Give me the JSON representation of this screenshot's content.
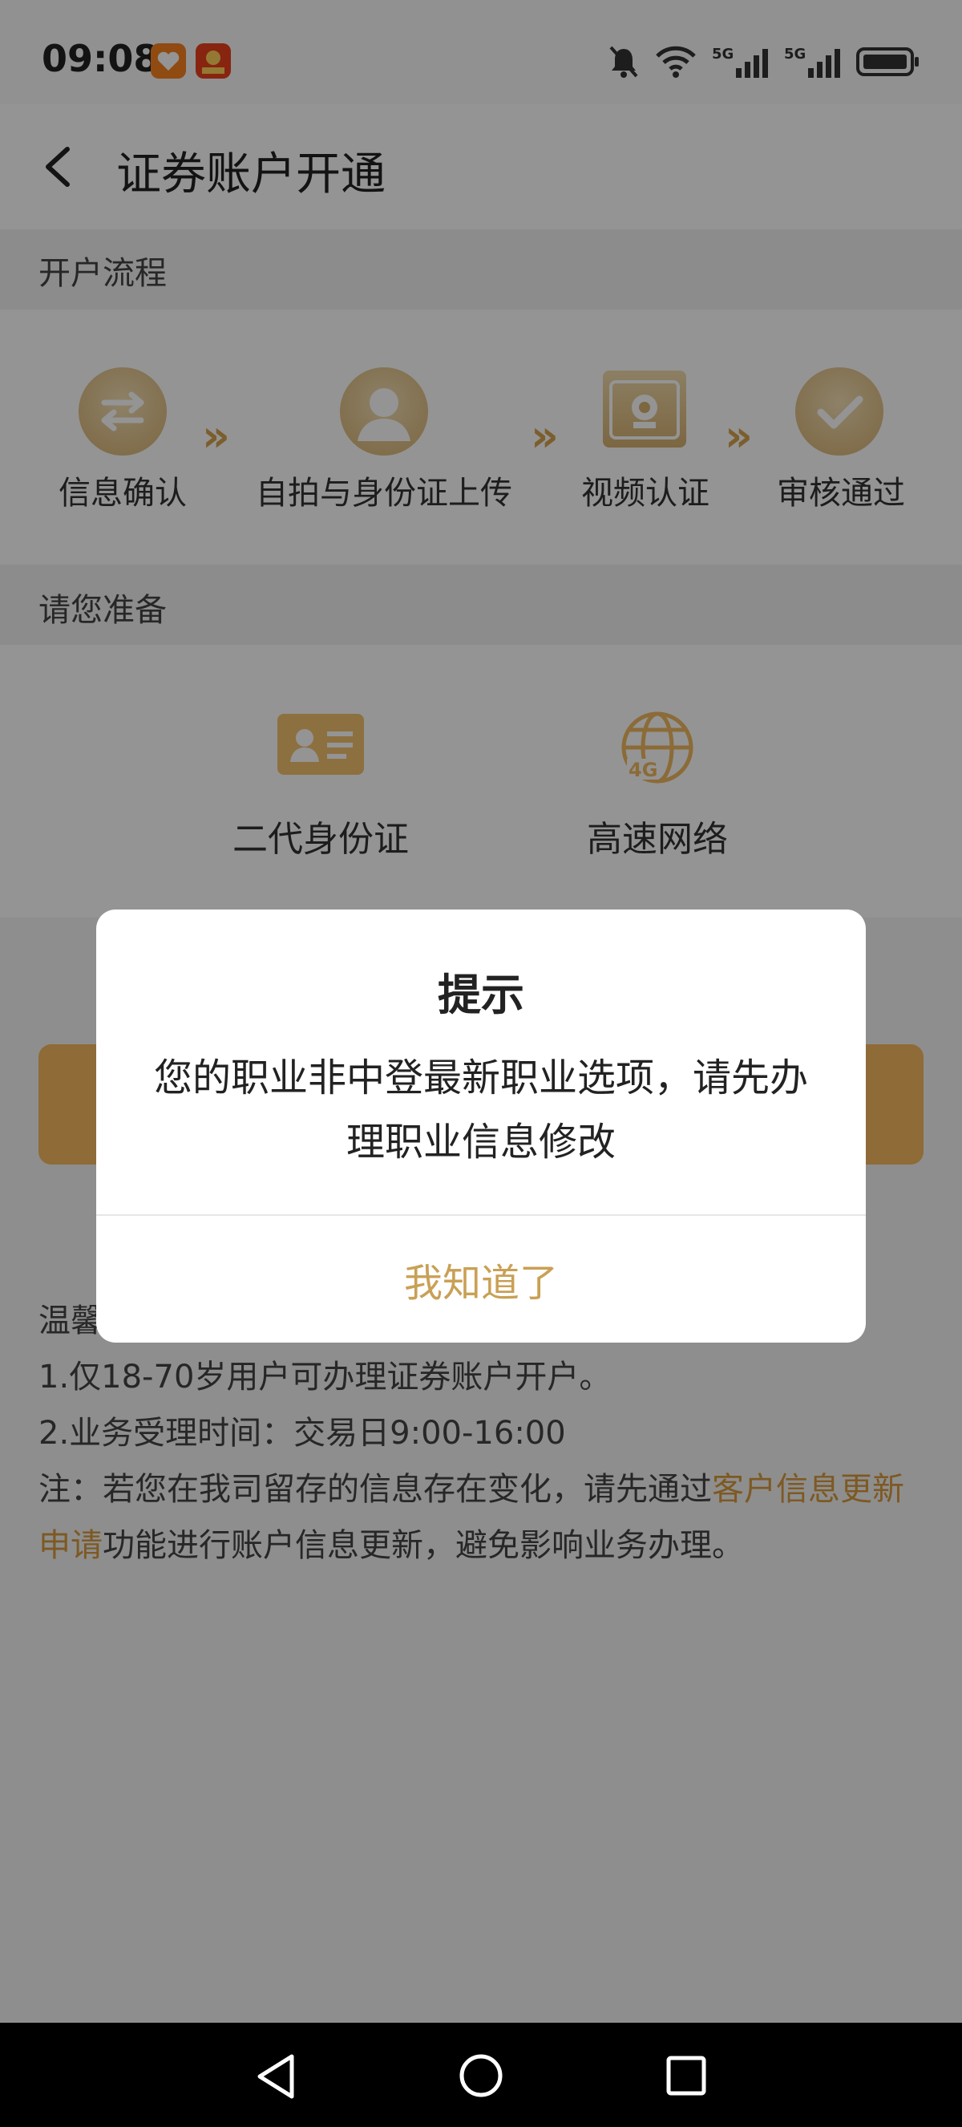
{
  "status_bar": {
    "time": "09:08"
  },
  "header": {
    "title": "证券账户开通"
  },
  "process": {
    "section_title": "开户流程",
    "steps": [
      {
        "label": "信息确认",
        "icon": "exchange-arrows-icon"
      },
      {
        "label": "自拍与身份证上传",
        "icon": "person-avatar-icon"
      },
      {
        "label": "视频认证",
        "icon": "webcam-icon"
      },
      {
        "label": "审核通过",
        "icon": "checkmark-icon"
      }
    ],
    "separator": "»"
  },
  "prepare": {
    "section_title": "请您准备",
    "items": [
      {
        "label": "二代身份证",
        "icon": "id-card-icon"
      },
      {
        "label": "高速网络",
        "icon": "globe-4g-icon"
      }
    ]
  },
  "notice": {
    "title_partial": "温馨",
    "line1": "1.仅18-70岁用户可办理证券账户开户。",
    "line2": "2.业务受理时间：交易日9:00-16:00",
    "line3_prefix": "注：若您在我司留存的信息存在变化，请先通过",
    "line3_link": "客户信息更新申请",
    "line3_suffix": "功能进行账户信息更新，避免影响业务办理。"
  },
  "dialog": {
    "title": "提示",
    "message": "您的职业非中登最新职业选项，请先办理职业信息修改",
    "confirm": "我知道了"
  },
  "colors": {
    "accent": "#c9a055",
    "gold": "#d6b171",
    "button": "#f4b960"
  }
}
